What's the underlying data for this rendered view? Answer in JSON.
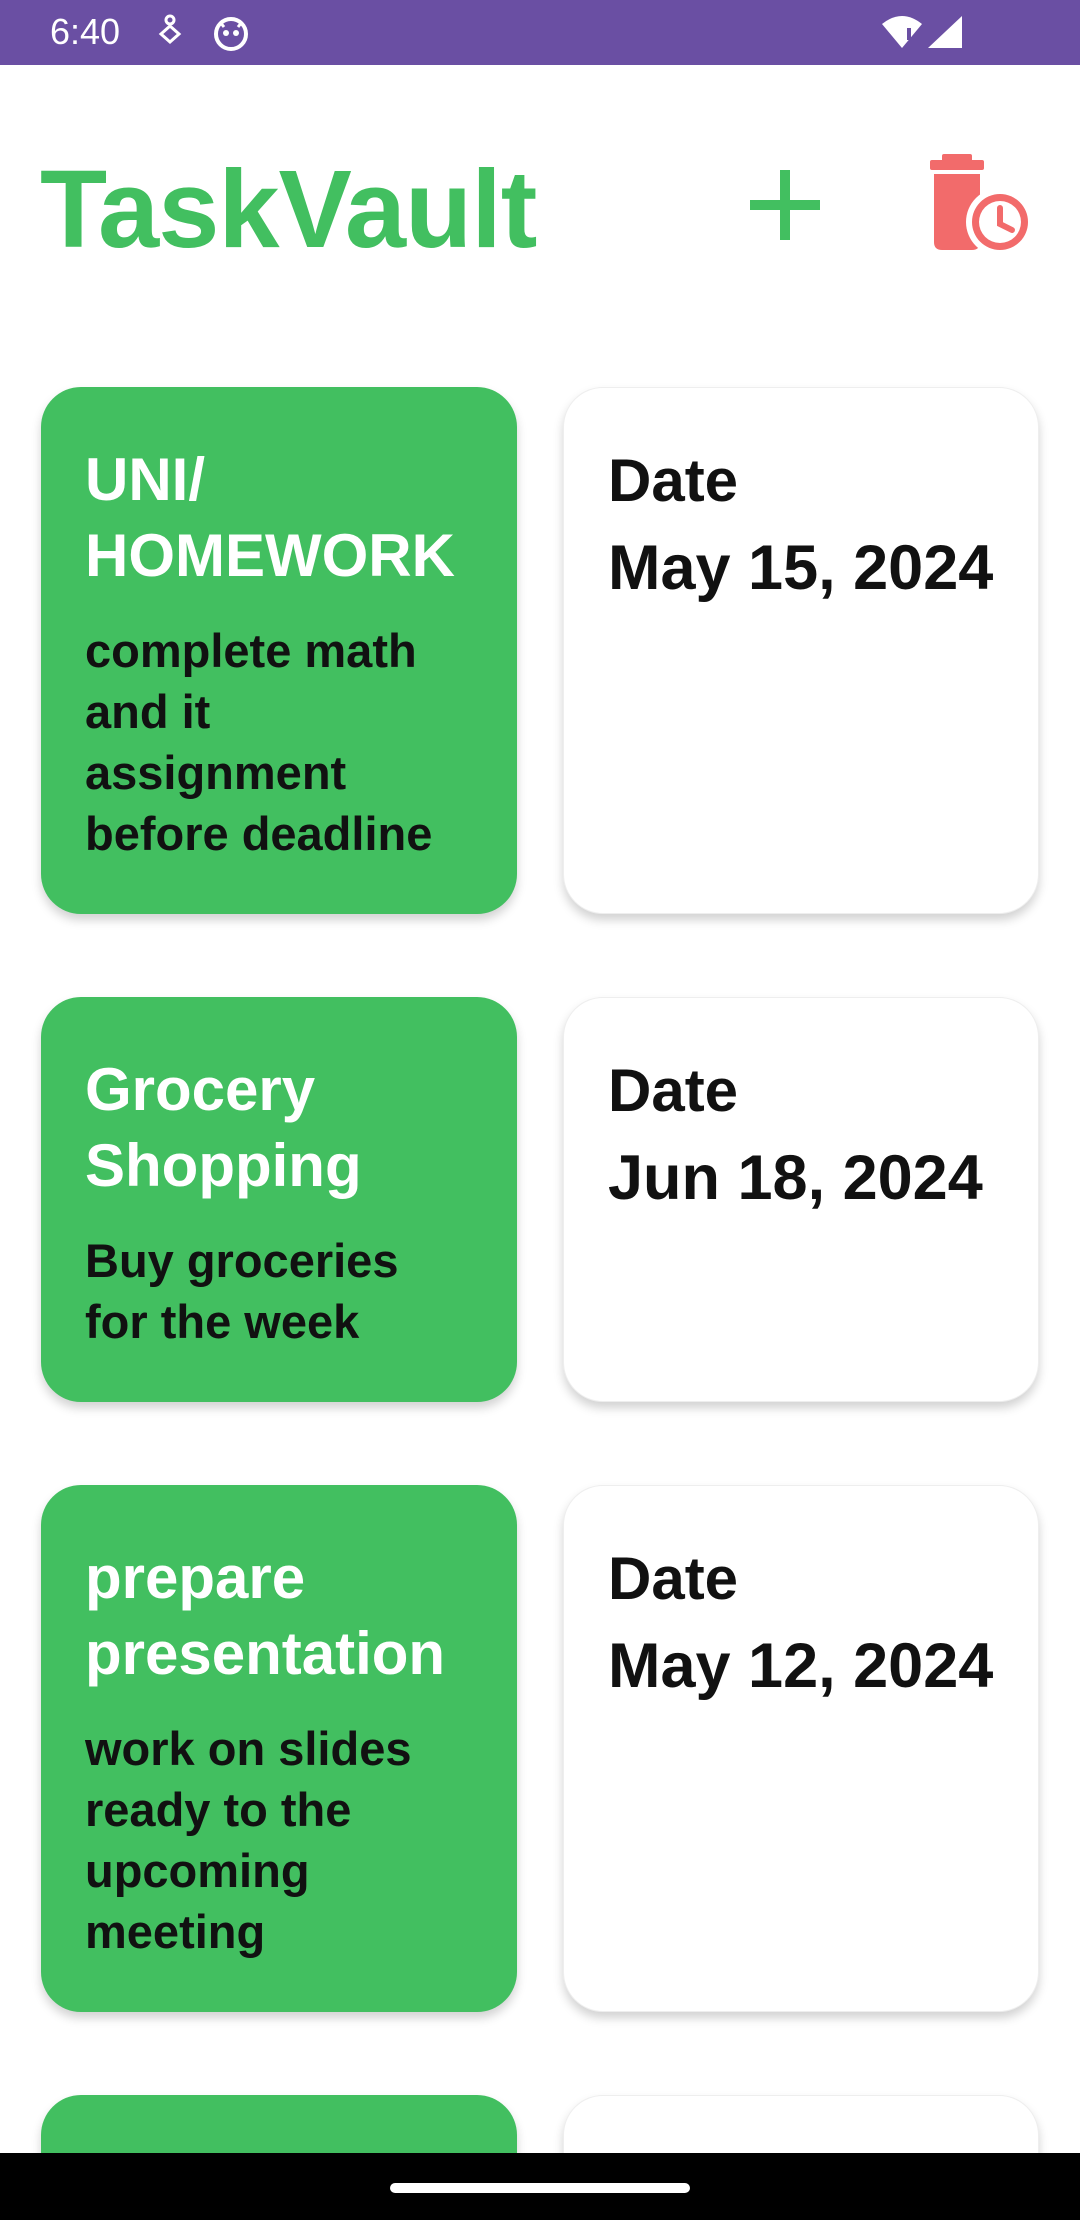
{
  "status_bar": {
    "time": "6:40",
    "icons": [
      "accessibility-icon",
      "app-notification-icon",
      "wifi-icon",
      "signal-icon"
    ]
  },
  "header": {
    "title": "TaskVault",
    "add_icon": "plus-icon",
    "delete_icon": "scheduled-delete-icon"
  },
  "colors": {
    "status_bar": "#6a4fa3",
    "accent_green": "#42bf60",
    "delete_red": "#f26b6b"
  },
  "tasks": [
    {
      "title": "UNI/ HOMEWORK",
      "description": "complete math and it assignment before deadline",
      "date_label": "Date",
      "date": "May 15, 2024"
    },
    {
      "title": "Grocery Shopping",
      "description": "Buy groceries for the week",
      "date_label": "Date",
      "date": "Jun 18, 2024"
    },
    {
      "title": "prepare presentation",
      "description": "work on slides ready to the upcoming meeting",
      "date_label": "Date",
      "date": "May 12, 2024"
    }
  ]
}
